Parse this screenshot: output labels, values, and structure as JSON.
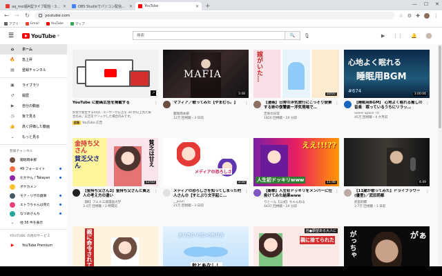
{
  "browser": {
    "tabs": [
      {
        "label": "aq_msr超A型ライブ配信・3511",
        "active": false,
        "color": "#e53935"
      },
      {
        "label": "OBS Studioでパソコン配信した",
        "active": false,
        "color": "#4285f4"
      },
      {
        "label": "YouTube",
        "active": true,
        "color": "#ff0000"
      }
    ],
    "new_tab": "+",
    "url": "youtube.com",
    "bookmarks": [
      {
        "label": "アプリ",
        "color": "#5f6368"
      },
      {
        "label": "Gmail",
        "color": "#ea4335"
      },
      {
        "label": "YouTube",
        "color": "#ff0000"
      },
      {
        "label": "マップ",
        "color": "#34a853"
      }
    ]
  },
  "youtube": {
    "logo_text": "YouTube",
    "logo_region": "JP",
    "search_placeholder": "検索"
  },
  "sidebar": {
    "items": [
      {
        "label": "ホーム",
        "icon": "home-icon",
        "glyph": "⌂",
        "active": true
      },
      {
        "label": "急上昇",
        "icon": "trending-icon",
        "glyph": "🔥",
        "active": false
      },
      {
        "label": "登録チャンネル",
        "icon": "subscriptions-icon",
        "glyph": "▤",
        "active": false
      }
    ],
    "library_items": [
      {
        "label": "ライブラリ",
        "icon": "library-icon",
        "glyph": "▣"
      },
      {
        "label": "履歴",
        "icon": "history-icon",
        "glyph": "↺"
      },
      {
        "label": "自分の動画",
        "icon": "your-videos-icon",
        "glyph": "▶"
      },
      {
        "label": "後で見る",
        "icon": "watch-later-icon",
        "glyph": "◷"
      },
      {
        "label": "高く評価した動画",
        "icon": "liked-icon",
        "glyph": "👍"
      },
      {
        "label": "もっと見る",
        "icon": "chevron-down-icon",
        "glyph": "⌄"
      }
    ],
    "subs_heading": "登録チャンネル",
    "subscriptions": [
      {
        "label": "闇堀雨本部",
        "color": "#6d4c41",
        "live": false
      },
      {
        "label": "49 フォーエイト",
        "color": "#ff7043",
        "live": true
      },
      {
        "label": "たかやん / Takayan",
        "color": "#8e24aa",
        "live": true
      },
      {
        "label": "ポケカメン",
        "color": "#fbc02d",
        "live": false
      },
      {
        "label": "モナ・リザの戯事",
        "color": "#455a64",
        "live": true
      },
      {
        "label": "エトラちゃんは見た",
        "color": "#ec407a",
        "live": true
      },
      {
        "label": "なつめさんち",
        "color": "#26a69a",
        "live": true
      },
      {
        "label": "他 56 件を表示",
        "color": "#ffffff",
        "live": false
      }
    ],
    "other_heading": "YOUTUBE の他のサービス",
    "premium_label": "YouTube Premium"
  },
  "videos": [
    {
      "title": "YouTube に動画広告を掲載する",
      "channel": "YouTube 広告",
      "desc": "料金が発生するのは、ユーザーが広告を 30 秒以上見た場合のみ。広告をクリックした場合のみです。",
      "is_ad": true,
      "ad_label": "広告",
      "avatar": "#ffffff",
      "thumb": "ad"
    },
    {
      "title": "マフィア／歌ってみた【やまむら。】",
      "channel": "闇堀雨本部",
      "stats": "12万 回視聴・3 日前",
      "duration": "3:48",
      "avatar": "#6d4c41",
      "thumb": "mafia",
      "thumb_text": "MAFIA"
    },
    {
      "title": "【漫画】日常の浮気旅行にこっそり便乗する姉の復讐劇ー浮気現場で…",
      "channel": "吉栄の日常",
      "stats": "1920 回視聴・24 分前",
      "duration": "10:07",
      "avatar": "#8d6e63",
      "thumb": "manga1",
      "thumb_text": "嫁がいた…"
    },
    {
      "title": "【睡眠用BGM】 心地よく眠れる癒しの音楽　眠っているうちにリラッ…",
      "channel": "Silent Space TV",
      "stats": "45万 回視聴・4 か月前",
      "duration": "3:00:06",
      "avatar": "#1565c0",
      "thumb": "sleep",
      "thumb_text": "心地よく眠れる",
      "thumb_text2": "睡眠用BGM",
      "thumb_num": "#674"
    },
    {
      "title": "【金持ち父さん2】金持ち父さんと貧乏人の考え方の違い",
      "channel": "【解】フェル三浦漫画大学",
      "stats": "3.4万 回視聴・3 時間前",
      "duration": "12:03",
      "avatar": "#212121",
      "thumb": "rich",
      "thumb_text": "金持ち父さん",
      "thumb_text2": "貧乏父さん",
      "thumb_text3": "貧乏は甘え"
    },
    {
      "title": "メディアの恐ろしさを知ってしまった村人さん😨【すとぷり文字起こ…",
      "channel": "__yuun",
      "stats": "21万 回視聴・3 日前",
      "duration": "3:50",
      "avatar": "#e0e0e0",
      "thumb": "media",
      "thumb_text": "メディアの恐ろしさ"
    },
    {
      "title": "【衝撃】人生初ドッキリをメンバーに仕掛けてみた結果www",
      "channel": "りとーん【公式】ちゃんねる",
      "stats": "4437 回視聴・24 分前",
      "duration": "11:46",
      "avatar": "#7e57c2",
      "thumb": "dokkiri",
      "thumb_text": "ええ!!!??",
      "thumb_text2": "人生初ドッキリwww"
    },
    {
      "title": "【11歳が歌ってみた】ドライフラワー(優里)／武田莉都",
      "channel": "武田莉都",
      "stats": "3.7万 回視聴・1 日前",
      "duration": "4:49",
      "avatar": "#bcaaa4",
      "thumb": "singer"
    },
    {
      "title": "",
      "channel": "",
      "stats": "",
      "duration": "",
      "avatar": "#fff",
      "thumb": "manga2",
      "thumb_text": "親に命令されて"
    },
    {
      "title": "",
      "channel": "",
      "stats": "",
      "duration": "",
      "avatar": "#fff",
      "thumb": "ribbon",
      "thumb_text": "きらきらリボンの作り方",
      "thumb_text2": "針と糸なし！"
    },
    {
      "title": "",
      "channel": "",
      "stats": "",
      "duration": "",
      "avatar": "#fff",
      "thumb": "manga3",
      "thumb_text": "自●願望ある大人に",
      "thumb_text2": "親に捨てられた"
    },
    {
      "title": "",
      "channel": "",
      "stats": "",
      "duration": "",
      "avatar": "#fff",
      "thumb": "man",
      "thumb_text": "がっちゃ",
      "thumb_text2": "がぁ"
    }
  ]
}
